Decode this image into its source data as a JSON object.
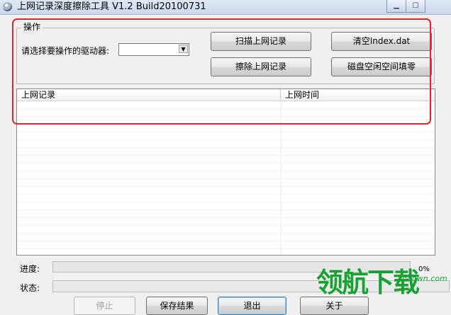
{
  "window": {
    "title": "上网记录深度擦除工具 V1.2   Build20100731",
    "min_label": "▁",
    "max_label": "▢",
    "close_label": "✕"
  },
  "group": {
    "legend": "操作",
    "drive_label": "请选择要操作的驱动器:",
    "drive_value": "",
    "dropdown_arrow": "▼"
  },
  "buttons": {
    "scan": "扫描上网记录",
    "erase": "擦除上网记录",
    "clear_index": "清空Index.dat",
    "fill_free": "磁盘空闲空间填零"
  },
  "list": {
    "columns": [
      "上网记录",
      "上网时间"
    ],
    "rows": []
  },
  "progress": {
    "label": "进度:",
    "percent_text": "0%",
    "value": 0
  },
  "status": {
    "label": "状态:",
    "value": ""
  },
  "bottom_buttons": {
    "stop": "停止",
    "save": "保存结果",
    "exit": "退出",
    "about": "关于"
  },
  "watermark": {
    "brand": "领航下载",
    "url": "lhdown.com"
  },
  "colors": {
    "highlight": "#e8232b",
    "watermark": "#1aa035"
  }
}
